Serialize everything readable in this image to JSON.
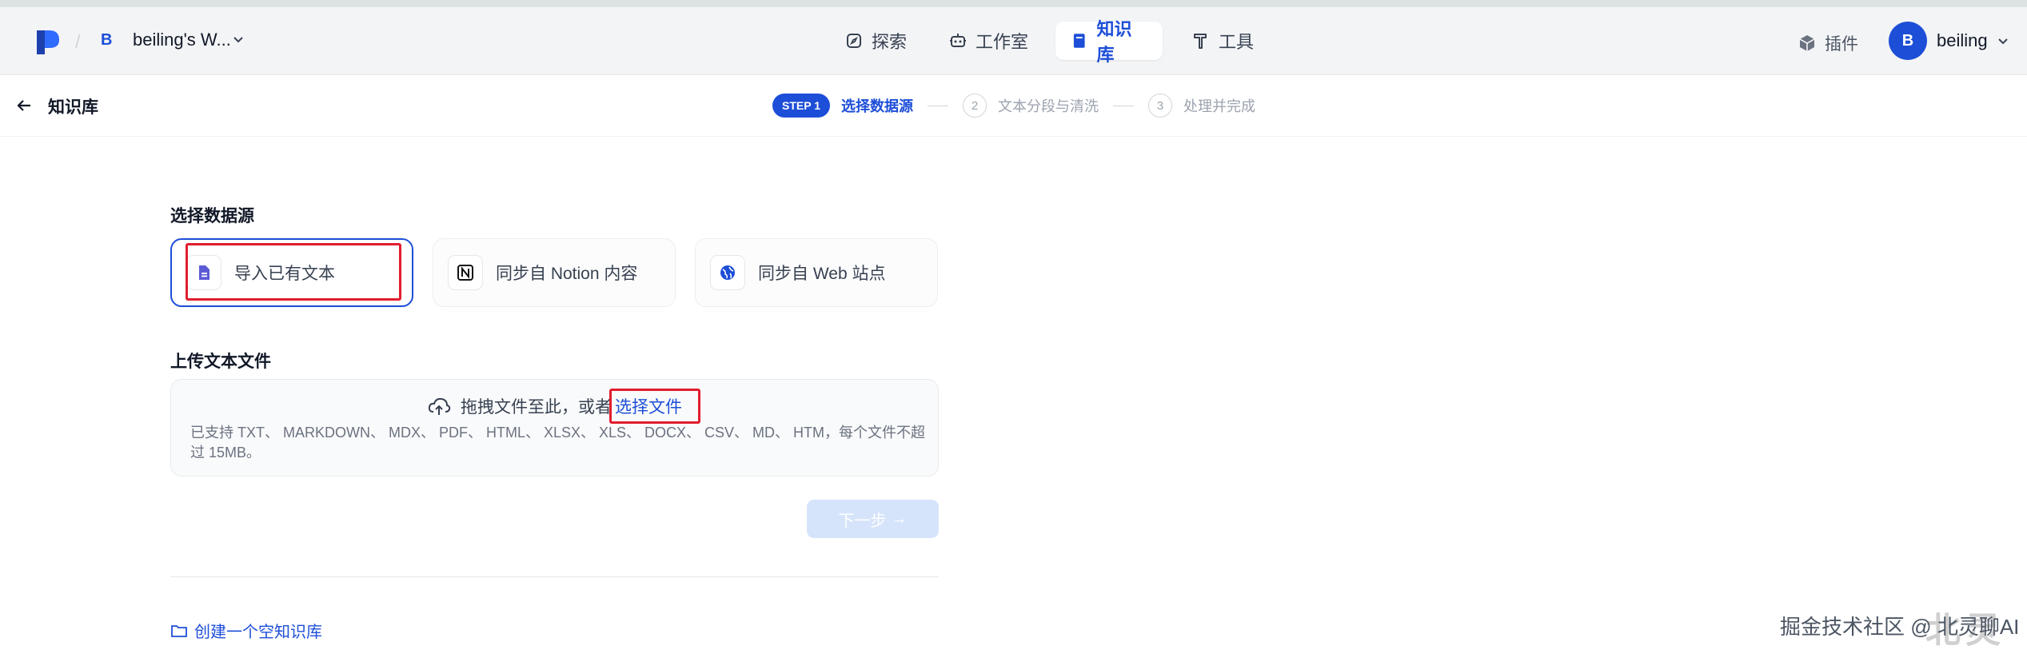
{
  "navbar": {
    "workspace": {
      "avatar_letter": "B",
      "name": "beiling's W..."
    },
    "tabs": [
      {
        "label": "探索",
        "icon": "compass-icon"
      },
      {
        "label": "工作室",
        "icon": "robot-icon"
      },
      {
        "label": "知识库",
        "icon": "book-icon",
        "active": true
      },
      {
        "label": "工具",
        "icon": "hammer-icon"
      }
    ],
    "plugin_label": "插件",
    "user": {
      "avatar_letter": "B",
      "name": "beiling"
    }
  },
  "subheader": {
    "back_title": "知识库",
    "steps": [
      {
        "badge": "STEP 1",
        "label": "选择数据源",
        "active": true
      },
      {
        "badge": "2",
        "label": "文本分段与清洗",
        "active": false
      },
      {
        "badge": "3",
        "label": "处理并完成",
        "active": false
      }
    ]
  },
  "main": {
    "source_title": "选择数据源",
    "sources": [
      {
        "label": "导入已有文本",
        "icon": "document-icon",
        "active": true
      },
      {
        "label": "同步自 Notion 内容",
        "icon": "notion-icon",
        "active": false
      },
      {
        "label": "同步自 Web 站点",
        "icon": "globe-icon",
        "active": false
      }
    ],
    "upload_title": "上传文本文件",
    "upload": {
      "prompt": "拖拽文件至此，或者",
      "link": "选择文件",
      "hint": "已支持 TXT、 MARKDOWN、 MDX、 PDF、 HTML、 XLSX、 XLS、 DOCX、 CSV、 MD、 HTM，每个文件不超过 15MB。"
    },
    "next_button": "下一步",
    "create_empty": "创建一个空知识库"
  },
  "watermark": {
    "text": "掘金技术社区 @ 北灵聊AI",
    "big": "北灵"
  },
  "colors": {
    "accent": "#1d4ed8",
    "highlight": "#e11d2e"
  }
}
